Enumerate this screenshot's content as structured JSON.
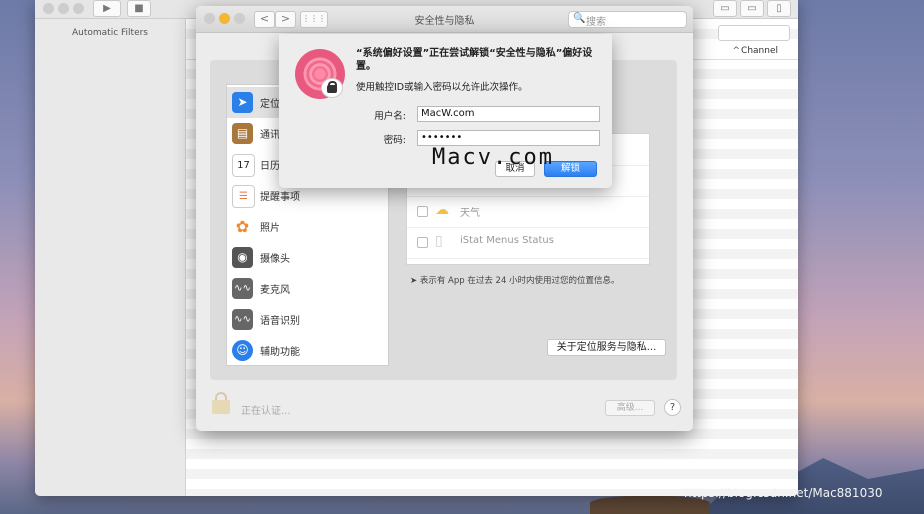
{
  "console": {
    "sidebar_label": "Automatic Filters",
    "column_channel": "Channel",
    "sort_indicator": "^"
  },
  "prefs": {
    "title": "安全性与隐私",
    "search_placeholder": "搜索",
    "back_glyph": "<",
    "forward_glyph": ">",
    "grid_glyph": "⋮⋮⋮",
    "sidebar_items": [
      {
        "label": "定位服务",
        "icon": "location-arrow-icon",
        "color": "#2a7fe8"
      },
      {
        "label": "通讯录",
        "icon": "contacts-book-icon",
        "color": "#a9773c"
      },
      {
        "label": "日历",
        "icon": "calendar-icon",
        "color": "#ffffff"
      },
      {
        "label": "提醒事项",
        "icon": "reminders-icon",
        "color": "#ffffff"
      },
      {
        "label": "照片",
        "icon": "photos-flower-icon",
        "color": "#ffffff"
      },
      {
        "label": "摄像头",
        "icon": "camera-icon",
        "color": "#555555"
      },
      {
        "label": "麦克风",
        "icon": "microphone-waveform-icon",
        "color": "#666666"
      },
      {
        "label": "语音识别",
        "icon": "speech-waveform-icon",
        "color": "#666666"
      },
      {
        "label": "辅助功能",
        "icon": "accessibility-icon",
        "color": "#2a7fe8"
      }
    ],
    "app_rows": [
      {
        "label": ""
      },
      {
        "label": ""
      },
      {
        "label": "天气",
        "icon": "weather-cloud-sun-icon"
      },
      {
        "label": "iStat Menus Status",
        "icon": "document-icon"
      }
    ],
    "location_note": "表示有 App 在过去 24 小时内使用过您的位置信息。",
    "about_button": "关于定位服务与隐私...",
    "auth_status": "正在认证...",
    "advanced_button": "高级...",
    "help_button": "?"
  },
  "auth_sheet": {
    "title": "“系统偏好设置”正在尝试解锁“安全性与隐私”偏好设置。",
    "subtitle": "使用触控ID或输入密码以允许此次操作。",
    "username_label": "用户名:",
    "username_value": "MacW.com",
    "password_label": "密码:",
    "password_value": "•••••••",
    "cancel_button": "取消",
    "unlock_button": "解锁"
  },
  "watermark": "Macv.com",
  "csdn_watermark": "https://blog.csdn.net/Mac881030",
  "colors": {
    "accent_blue": "#2a7ff2",
    "fingerprint_pink": "#f06a8d"
  }
}
